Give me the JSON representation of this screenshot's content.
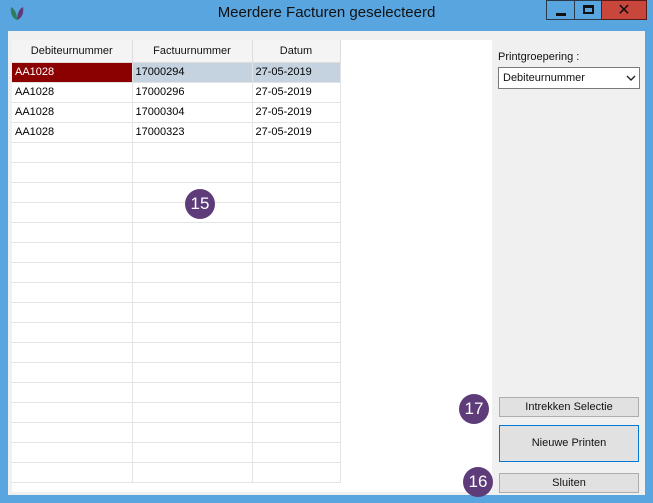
{
  "window": {
    "title": "Meerdere Facturen geselecteerd",
    "close_glyph": "✕"
  },
  "grid": {
    "columns": [
      "Debiteurnummer",
      "Factuurnummer",
      "Datum"
    ],
    "rows": [
      [
        "AA1028",
        "17000294",
        "27-05-2019"
      ],
      [
        "AA1028",
        "17000296",
        "27-05-2019"
      ],
      [
        "AA1028",
        "17000304",
        "27-05-2019"
      ],
      [
        "AA1028",
        "17000323",
        "27-05-2019"
      ]
    ],
    "selected_row": 0
  },
  "printgroepering": {
    "label": "Printgroepering :",
    "value": "Debiteurnummer"
  },
  "buttons": {
    "intrekken": "Intrekken Selectie",
    "nieuwe_printen": "Nieuwe Printen",
    "sluiten": "Sluiten"
  },
  "markers": {
    "grid": "15",
    "intrekken": "17",
    "sluiten": "16"
  },
  "colors": {
    "titlebar": "#59a5df",
    "selected_cell": "#8b0000",
    "selected_row": "#c5d3e0",
    "marker": "#5e3c7a"
  }
}
